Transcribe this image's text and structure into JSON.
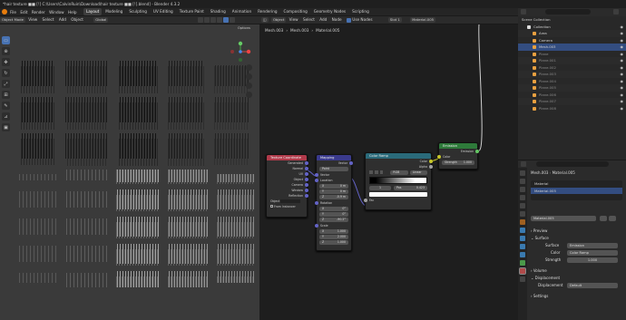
{
  "titlebar": {
    "text": "*hair texture ■■ [!] C:\\Users\\CalvinRuin\\Download\\hair texture ■■ [!].blend] - Blender 4.3.2"
  },
  "menubar": {
    "menus": [
      "File",
      "Edit",
      "Render",
      "Window",
      "Help"
    ],
    "workspaces": [
      "Layout",
      "Modeling",
      "Sculpting",
      "UV Editing",
      "Texture Paint",
      "Shading",
      "Animation",
      "Rendering",
      "Compositing",
      "Geometry Nodes",
      "Scripting"
    ],
    "active_workspace": "Layout",
    "scene_label": "Scene",
    "viewlayer_label": "ViewLayer"
  },
  "viewport": {
    "mode": "Object Mode",
    "menus": [
      "View",
      "Select",
      "Add",
      "Object"
    ],
    "orientation": "Global",
    "options_label": "Options"
  },
  "node_editor": {
    "type": "Object",
    "menus": [
      "View",
      "Select",
      "Add",
      "Node"
    ],
    "use_nodes_label": "Use Nodes",
    "slot": "Slot 1",
    "material": "Material.005",
    "breadcrumb": [
      "Mesh.003",
      "Mesh.003",
      "Material.005"
    ],
    "nodes": {
      "texcoord": {
        "title": "Texture Coordinate",
        "outputs": [
          "Generated",
          "Normal",
          "UV",
          "Object",
          "Camera",
          "Window",
          "Reflection"
        ],
        "object_label": "Object",
        "from_instancer": "From Instancer"
      },
      "mapping": {
        "title": "Mapping",
        "output": "Vector",
        "type": "Point",
        "input": "Vector",
        "location_label": "Location",
        "location": [
          "X",
          "0 m",
          "Y",
          "0 m",
          "Z",
          "-0.9 m"
        ],
        "rotation_label": "Rotation",
        "rotation": [
          "X",
          "0°",
          "Y",
          "0°",
          "Z",
          "-90.2°"
        ],
        "scale_label": "Scale",
        "scale": [
          "X",
          "1.000",
          "Y",
          "2.000",
          "Z",
          "1.000"
        ]
      },
      "colorramp": {
        "title": "Color Ramp",
        "outputs": [
          "Color",
          "Alpha"
        ],
        "mode": "RGB",
        "interp": "Linear",
        "index": "1",
        "pos_label": "Pos",
        "pos": "0.423",
        "input": "Fac"
      },
      "emission": {
        "title": "Emission",
        "output": "Emission",
        "color_label": "Color",
        "strength_label": "Strength",
        "strength": "1.000"
      }
    }
  },
  "outliner": {
    "title": "Scene Collection",
    "items": [
      {
        "name": "Collection",
        "indent": 1
      },
      {
        "name": "Area",
        "indent": 2
      },
      {
        "name": "Camera",
        "indent": 2
      },
      {
        "name": "Mesh.003",
        "indent": 2,
        "selected": true
      },
      {
        "name": "Plane",
        "indent": 2
      },
      {
        "name": "Plane.001",
        "indent": 2
      },
      {
        "name": "Plane.002",
        "indent": 2
      },
      {
        "name": "Plane.003",
        "indent": 2
      },
      {
        "name": "Plane.004",
        "indent": 2
      },
      {
        "name": "Plane.005",
        "indent": 2
      },
      {
        "name": "Plane.006",
        "indent": 2
      },
      {
        "name": "Plane.007",
        "indent": 2
      },
      {
        "name": "Plane.008",
        "indent": 2
      }
    ]
  },
  "properties": {
    "breadcrumb_object": "Mesh.003",
    "breadcrumb_material": "Material.005",
    "slots": [
      "Material",
      "Material.005"
    ],
    "material_name": "Material.005",
    "panels": {
      "preview": "Preview",
      "surface": "Surface",
      "surface_label": "Surface",
      "surface_value": "Emission",
      "color_label": "Color",
      "color_value": "Color Ramp",
      "strength_label": "Strength",
      "strength_value": "1.000",
      "volume": "Volume",
      "displacement": "Displacement",
      "displacement_label": "Displacement",
      "displacement_value": "Default",
      "settings": "Settings"
    }
  },
  "colors": {
    "accent": "#4772b3",
    "texcoord_header": "#b03a4a",
    "mapping_header": "#3a3a8c",
    "colorramp_header": "#2a6a7a",
    "emission_header": "#2e7a3a"
  }
}
